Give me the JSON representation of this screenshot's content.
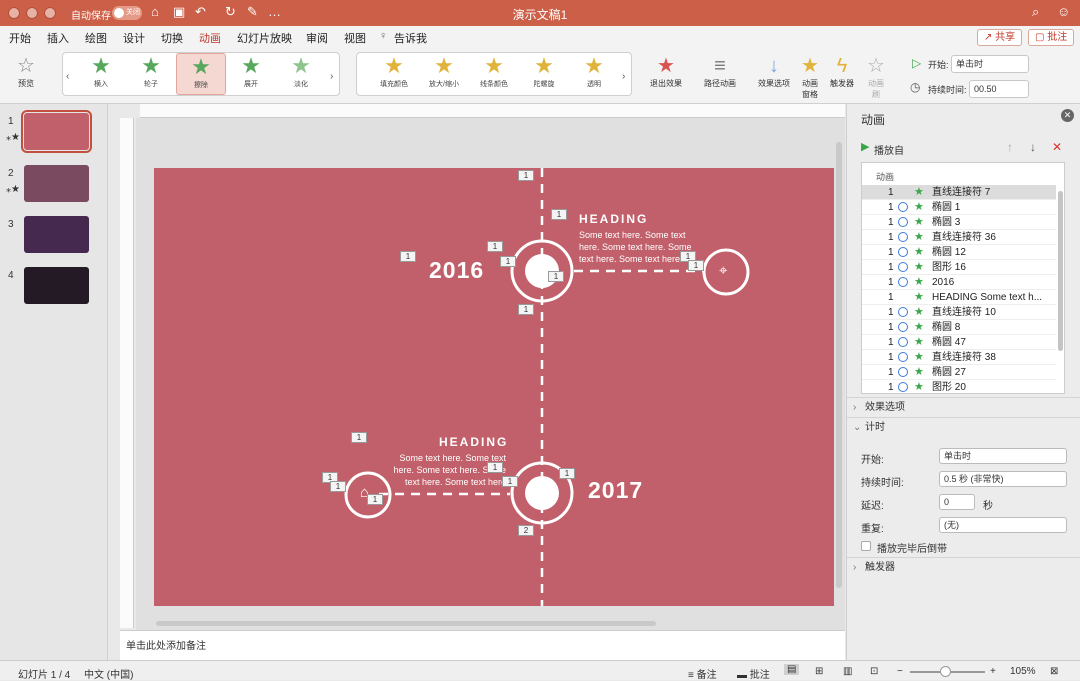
{
  "window": {
    "autosave": "自动保存",
    "toggle": "关闭",
    "title": "演示文稿1"
  },
  "menu": [
    "开始",
    "插入",
    "绘图",
    "设计",
    "切换",
    "动画",
    "幻灯片放映",
    "审阅",
    "视图",
    "告诉我"
  ],
  "share": "共享",
  "comment": "批注",
  "ribbon": {
    "preview": "预览",
    "gallery1": [
      {
        "label": "横入",
        "color": "#57a85d"
      },
      {
        "label": "轮子",
        "color": "#57a85d"
      },
      {
        "label": "擦除",
        "color": "#57a85d"
      },
      {
        "label": "展开",
        "color": "#57a85d"
      },
      {
        "label": "淡化",
        "color": "#57a85d"
      }
    ],
    "gallery2": [
      {
        "label": "填充颜色",
        "color": "#e0b33a"
      },
      {
        "label": "放大/缩小",
        "color": "#e0b33a"
      },
      {
        "label": "线条颜色",
        "color": "#e0b33a"
      },
      {
        "label": "陀螺旋",
        "color": "#e0b33a"
      },
      {
        "label": "透明",
        "color": "#e0b33a"
      }
    ],
    "exit": "退出效果",
    "path": "路径动画",
    "effect_options": "效果选项",
    "anim_pane": "动画\n窗格",
    "trigger": "触发器",
    "reorder": "动画\n刷",
    "start_label": "开始:",
    "start_val": "单击时",
    "duration_label": "持续时间:",
    "duration_val": "00.50"
  },
  "slides": [
    "1",
    "2",
    "3",
    "4"
  ],
  "slide": {
    "year1": "2016",
    "year2": "2017",
    "heading": "HEADING",
    "body": "Some text here. Some text here. Some text here. Some text here. Some text here"
  },
  "badges": {
    "one": "1",
    "two": "2"
  },
  "panel": {
    "title": "动画",
    "play": "播放自",
    "list_header": "动画",
    "rows": [
      {
        "n": "1",
        "name": "直线连接符 7",
        "clock": false
      },
      {
        "n": "1",
        "name": "椭圆 1",
        "clock": true
      },
      {
        "n": "1",
        "name": "椭圆 3",
        "clock": true
      },
      {
        "n": "1",
        "name": "直线连接符 36",
        "clock": true
      },
      {
        "n": "1",
        "name": "椭圆 12",
        "clock": true
      },
      {
        "n": "1",
        "name": "图形 16",
        "clock": true
      },
      {
        "n": "1",
        "name": "2016",
        "clock": true
      },
      {
        "n": "1",
        "name": "HEADING Some text h...",
        "clock": false
      },
      {
        "n": "1",
        "name": "直线连接符 10",
        "clock": true
      },
      {
        "n": "1",
        "name": "椭圆 8",
        "clock": true
      },
      {
        "n": "1",
        "name": "椭圆 47",
        "clock": true
      },
      {
        "n": "1",
        "name": "直线连接符 38",
        "clock": true
      },
      {
        "n": "1",
        "name": "椭圆 27",
        "clock": true
      },
      {
        "n": "1",
        "name": "图形 20",
        "clock": true
      }
    ],
    "effect_options": "效果选项",
    "timing": "计时",
    "start_label": "开始:",
    "start_val": "单击时",
    "duration_label": "持续时间:",
    "duration_val": "0.5 秒 (非常快)",
    "delay_label": "延迟:",
    "delay_val": "0",
    "delay_unit": "秒",
    "repeat_label": "重复:",
    "repeat_val": "(无)",
    "rewind": "播放完毕后倒带",
    "trigger": "触发器"
  },
  "notes": "单击此处添加备注",
  "status": {
    "slide": "幻灯片 1 / 4",
    "lang": "中文 (中国)",
    "notes": "备注",
    "comments": "批注",
    "zoom": "105%"
  },
  "colors": {
    "accent": "#cc5f47",
    "slide_bg": "#c1606a"
  }
}
